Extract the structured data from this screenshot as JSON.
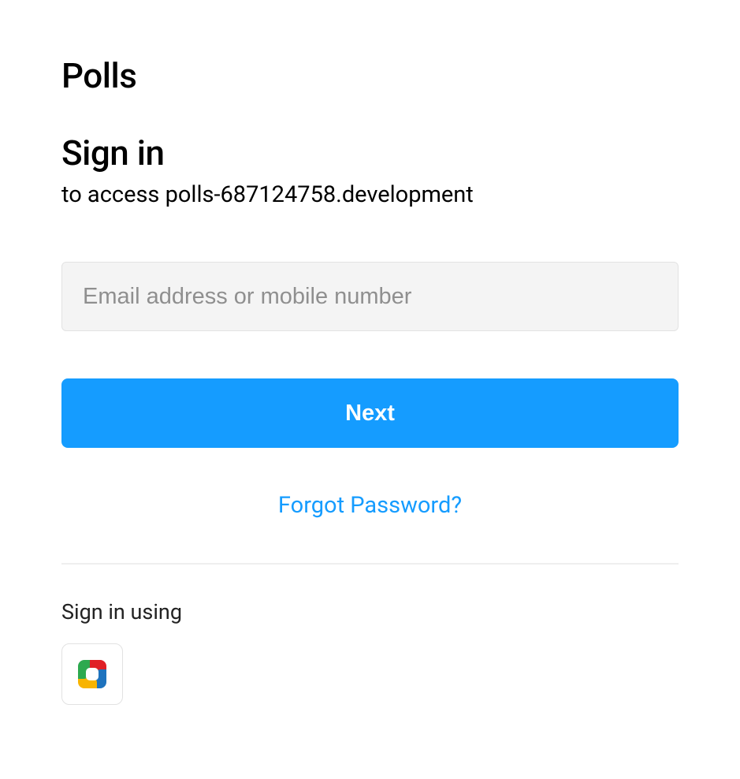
{
  "app_title": "Polls",
  "signin": {
    "heading": "Sign in",
    "subtext": "to access polls-687124758.development",
    "email_placeholder": "Email address or mobile number",
    "next_label": "Next",
    "forgot_label": "Forgot Password?",
    "using_label": "Sign in using"
  },
  "sso": {
    "providers": [
      {
        "name": "zoho"
      }
    ]
  }
}
